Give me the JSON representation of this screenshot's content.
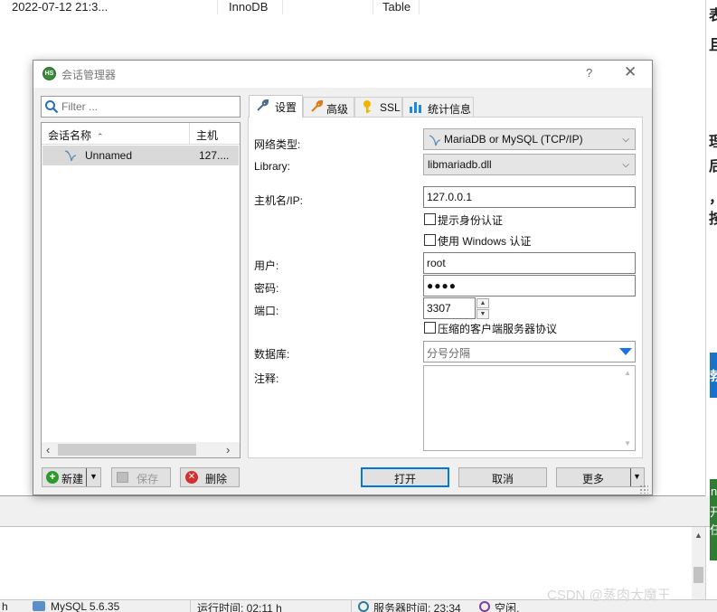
{
  "background": {
    "table_row": {
      "date": "2022-07-12 21:3...",
      "engine": "InnoDB",
      "type": "Table"
    },
    "status_bar": {
      "left": "h",
      "server": "MySQL 5.6.35",
      "uptime": "运行时间: 02:11 h",
      "server_time": "服务器时间: 23:34",
      "idle": "空闲."
    },
    "right_strip_chars": [
      "表",
      "且",
      "理",
      "后",
      "，",
      "按",
      "勃",
      "n",
      "开",
      "任"
    ],
    "watermark": "CSDN @蒸肉大魔王"
  },
  "dialog": {
    "title": "会话管理器",
    "help_label": "?",
    "close_label": "✕",
    "icon_text": "HS"
  },
  "sessions": {
    "filter_placeholder": "Filter ...",
    "column_name": "会话名称",
    "column_host": "主机",
    "rows": [
      {
        "name": "Unnamed",
        "host": "127...."
      }
    ],
    "buttons": {
      "new": "新建",
      "save": "保存",
      "delete": "删除"
    }
  },
  "tabs": [
    {
      "label": "设置",
      "icon": "wrench-icon",
      "active": true
    },
    {
      "label": "高级",
      "icon": "wrench-orange-icon",
      "active": false
    },
    {
      "label": "SSL",
      "icon": "key-icon",
      "active": false
    },
    {
      "label": "统计信息",
      "icon": "bar-chart-icon",
      "active": false
    }
  ],
  "settings": {
    "network_type_label": "网络类型:",
    "network_type_value": "MariaDB or MySQL (TCP/IP)",
    "library_label": "Library:",
    "library_value": "libmariadb.dll",
    "host_label": "主机名/IP:",
    "host_value": "127.0.0.1",
    "prompt_auth_label": "提示身份认证",
    "prompt_auth_checked": false,
    "windows_auth_label": "使用 Windows 认证",
    "windows_auth_checked": false,
    "user_label": "用户:",
    "user_value": "root",
    "password_label": "密码:",
    "password_value": "●●●●",
    "port_label": "端口:",
    "port_value": "3307",
    "compressed_label": "压缩的客户端服务器协议",
    "compressed_checked": false,
    "database_label": "数据库:",
    "database_placeholder": "分号分隔",
    "comment_label": "注释:",
    "comment_value": ""
  },
  "footer_buttons": {
    "open": "打开",
    "cancel": "取消",
    "more": "更多"
  },
  "colors": {
    "accent": "#0078d7",
    "dropdown_triangle": "#1a73e8",
    "selected_row": "#d9d9d9"
  }
}
